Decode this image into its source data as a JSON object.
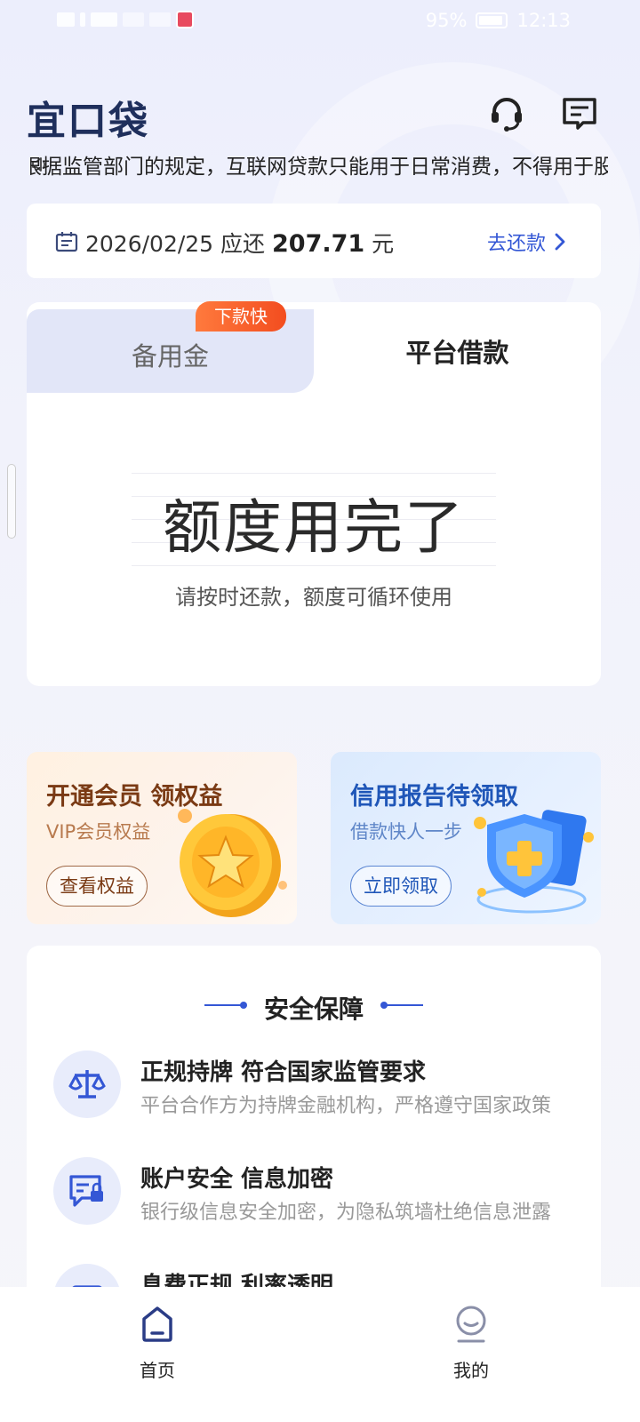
{
  "status_bar": {
    "battery": "95%",
    "time": "12:13"
  },
  "header": {
    "logo_text": "宜口袋"
  },
  "notice": {
    "text": "根据监管部门的规定，互联网贷款只能用于日常消费，不得用于股票、债券"
  },
  "repay": {
    "date": "2026/02/25",
    "due_label": "应还",
    "amount": "207.71",
    "unit": "元",
    "action": "去还款"
  },
  "loan_card": {
    "tabs": [
      {
        "label": "备用金",
        "badge": "下款快",
        "active": false
      },
      {
        "label": "平台借款",
        "active": true
      }
    ],
    "title": "额度用完了",
    "subtitle": "请按时还款，额度可循环使用"
  },
  "promos": [
    {
      "title": "开通会员 领权益",
      "subtitle": "VIP会员权益",
      "button": "查看权益"
    },
    {
      "title": "信用报告待领取",
      "subtitle": "借款快人一步",
      "button": "立即领取"
    }
  ],
  "safety": {
    "title": "安全保障",
    "items": [
      {
        "head": "正规持牌 符合国家监管要求",
        "desc": "平台合作方为持牌金融机构，严格遵守国家政策"
      },
      {
        "head": "账户安全 信息加密",
        "desc": "银行级信息安全加密，为隐私筑墙杜绝信息泄露"
      },
      {
        "head": "息费正规 利率透明",
        "desc": ""
      }
    ]
  },
  "bottom_nav": [
    {
      "label": "首页",
      "icon": "home-icon",
      "active": true
    },
    {
      "label": "我的",
      "icon": "profile-icon",
      "active": false
    }
  ],
  "colors": {
    "accent": "#3457d5",
    "badge": "#f34d1f",
    "brand_dark": "#1f2f5c"
  }
}
